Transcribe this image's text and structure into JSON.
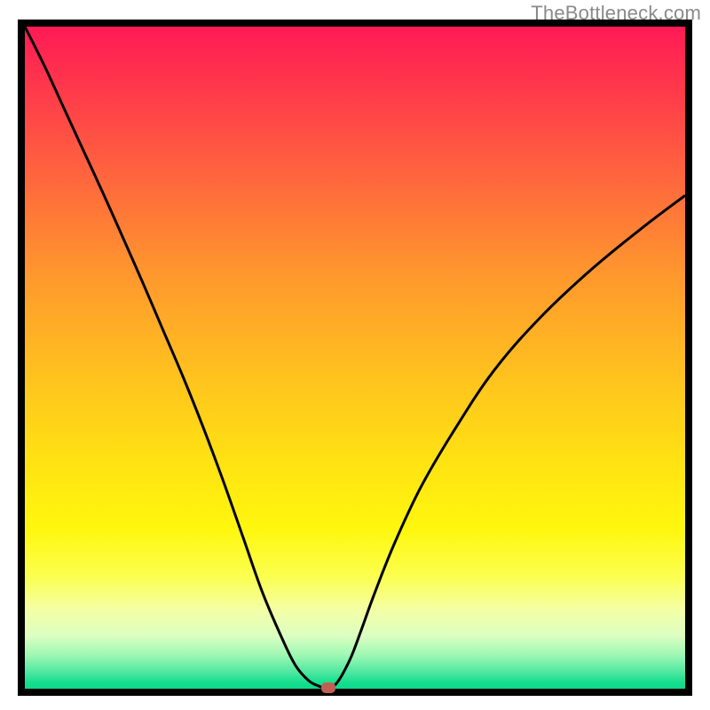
{
  "watermark": "TheBottleneck.com",
  "colors": {
    "page_bg": "#ffffff",
    "plot_border": "#000000",
    "curve": "#000000",
    "marker": "#c06054",
    "watermark_text": "#8a8a8a",
    "gradient_top": "#ff1a55",
    "gradient_bottom": "#0fd98b"
  },
  "chart_data": {
    "type": "line",
    "title": "",
    "xlabel": "",
    "ylabel": "",
    "xlim": [
      0,
      100
    ],
    "ylim": [
      0,
      100
    ],
    "grid": false,
    "legend": false,
    "x": [
      0,
      3,
      6,
      9,
      12,
      15,
      18,
      21,
      24,
      27,
      30,
      33,
      36,
      39,
      41,
      43,
      44.5,
      45.3,
      46.2,
      47,
      48,
      49.5,
      51,
      53,
      56,
      60,
      65,
      71,
      78,
      86,
      94,
      100
    ],
    "y": [
      100,
      94,
      87.5,
      81,
      74.5,
      67.8,
      61,
      54,
      47,
      39.5,
      31.5,
      23,
      14.5,
      7.5,
      3.5,
      1.2,
      0.4,
      0.15,
      0.15,
      0.6,
      2,
      5,
      9,
      14.5,
      22,
      30.5,
      39,
      48,
      56,
      63.5,
      70,
      74.5
    ],
    "marker_point": {
      "x": 46,
      "y": 0.15
    },
    "notes": "x and y are normalized 0–100; no axis ticks or labels visible in image"
  }
}
